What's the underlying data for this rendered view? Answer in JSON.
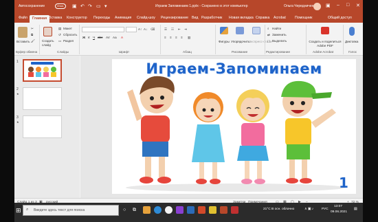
{
  "titlebar": {
    "autosave": "Автосохранение",
    "toggle": "Откл.",
    "title": "Играем Запоминаем 1.pptx  -  Сохранено в этот компьютер",
    "user": "Ольга Чередниченко"
  },
  "menu_tabs": [
    "Файл",
    "Главная",
    "Вставка",
    "Конструктор",
    "Переходы",
    "Анимация",
    "Слайд-шоу",
    "Рецензирование",
    "Вид",
    "Разработчик",
    "Новая вкладка",
    "Справка",
    "Acrobat",
    "Помощник",
    "Общий доступ"
  ],
  "ribbon": {
    "paste": "Вставить",
    "create_slide": "Создать слайд",
    "layout": "Макет",
    "reset": "Сбросить",
    "section": "Раздел",
    "shapes": "Фигуры",
    "arrange": "Упорядочить",
    "quick_styles": "Экспресс-стили",
    "find": "Найти",
    "replace": "Заменить",
    "select": "Выделить",
    "acrobat_share": "Создать и поделиться Adobe PDF",
    "dictate": "Диктовка",
    "groups": {
      "clipboard": "Буфер обмена",
      "slides": "Слайды",
      "font": "Шрифт",
      "paragraph": "Абзац",
      "drawing": "Рисование",
      "editing": "Редактирование",
      "acrobat": "Adobe Acrobat",
      "voice": "Голос"
    }
  },
  "thumbnails": [
    {
      "num": "1"
    },
    {
      "num": "2"
    },
    {
      "num": "3"
    }
  ],
  "slide": {
    "title": "Играем-Запоминаем",
    "number": "1"
  },
  "statusbar": {
    "slide": "Слайд 1 из 3",
    "lang": "русский",
    "notes": "Заметки",
    "comments": "Примечания",
    "zoom": "72 %"
  },
  "taskbar": {
    "search": "Введите здесь текст для поиска",
    "weather": "21°C  В осн. облачно",
    "lang": "РУС",
    "time": "13:07",
    "date": "09.06.2021"
  },
  "colors": {
    "accent": "#b7472a",
    "title_blue": "#1e63c9"
  }
}
